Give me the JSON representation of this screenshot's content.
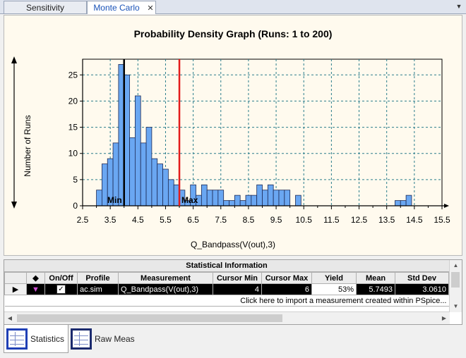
{
  "tabs": [
    {
      "label": "Sensitivity",
      "active": false
    },
    {
      "label": "Monte Carlo",
      "active": true
    }
  ],
  "chart_data": {
    "type": "bar",
    "title": "Probability Density Graph (Runs: 1 to 200)",
    "xlabel": "Q_Bandpass(V(out),3)",
    "ylabel": "Number of Runs",
    "xlim": [
      2.5,
      15.5
    ],
    "ylim": [
      0,
      28
    ],
    "xticks": [
      "2.5",
      "3.5",
      "4.5",
      "5.5",
      "6.5",
      "7.5",
      "8.5",
      "9.5",
      "10.5",
      "11.5",
      "12.5",
      "13.5",
      "14.5",
      "15.5"
    ],
    "minor_xticks": [
      "3.0",
      "4.0",
      "5.0",
      "6.0",
      "7.0",
      "8.0",
      "9.0",
      "10.0",
      "11.0",
      "12.0",
      "13.0",
      "14.0",
      "15.0"
    ],
    "yticks": [
      "0",
      "5",
      "10",
      "15",
      "20",
      "25"
    ],
    "bin_start": 3.0,
    "bin_width": 0.2,
    "values": [
      3,
      8,
      9,
      12,
      27,
      25,
      13,
      21,
      12,
      15,
      9,
      8,
      7,
      5,
      4,
      3,
      1,
      4,
      2,
      4,
      3,
      3,
      3,
      1,
      1,
      2,
      1,
      2,
      2,
      4,
      3,
      4,
      3,
      3,
      3,
      0,
      2,
      0,
      0,
      0,
      0,
      0,
      0,
      0,
      0,
      0,
      0,
      0,
      0,
      0,
      0,
      0,
      0,
      0,
      1,
      1,
      2
    ],
    "bar_color": "#6aa7f2",
    "grid": true,
    "cursor_min": {
      "label": "Min",
      "value": 4.0,
      "color": "#000000"
    },
    "cursor_max": {
      "label": "Max",
      "value": 6.0,
      "color": "#e31b1b"
    }
  },
  "stats": {
    "caption": "Statistical Information",
    "columns": [
      "",
      "◆",
      "On/Off",
      "Profile",
      "Measurement",
      "Cursor Min",
      "Cursor Max",
      "Yield",
      "Mean",
      "Std Dev"
    ],
    "row": {
      "profile": "ac.sim",
      "measurement": "Q_Bandpass(V(out),3)",
      "cursor_min": "4",
      "cursor_max": "6",
      "yield": "53%",
      "mean": "5.7493",
      "std_dev": "3.0610"
    },
    "import_text": "Click here to import a measurement created within PSpice..."
  },
  "bottom_tabs": [
    {
      "label": "Statistics",
      "active": true
    },
    {
      "label": "Raw Meas",
      "active": false
    }
  ]
}
